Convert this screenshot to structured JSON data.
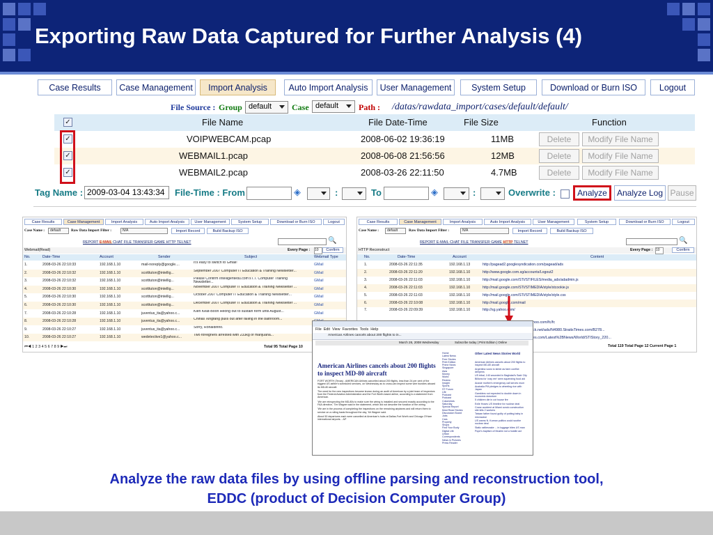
{
  "slide": {
    "title": "Exporting Raw Data Captured for Further Analysis (4)",
    "caption_line1": "Analyze the raw data files by using offline parsing and reconstruction tool,",
    "caption_line2": "EDDC (product of Decision Computer Group)"
  },
  "colors": {
    "title_bg": "#0d2478",
    "accent_red": "#d0101a",
    "caption": "#1d2ab8"
  },
  "main": {
    "nav": [
      "Case Results",
      "Case Management",
      "Import Analysis",
      "Auto Import Analysis",
      "User Management",
      "System Setup",
      "Download or Burn ISO",
      "Logout"
    ],
    "active_tab": "Import Analysis",
    "file_source_label": "File Source :",
    "group_label": "Group",
    "group_value": "default",
    "case_label": "Case",
    "case_value": "default",
    "path_label": "Path :",
    "path_value": "/datas/rawdata_import/cases/default/default/",
    "columns": [
      "File Name",
      "File Date-Time",
      "File Size",
      "Function"
    ],
    "files": [
      {
        "name": "VOIPWEBCAM.pcap",
        "datetime": "2008-06-02 19:36:19",
        "size": "11MB",
        "checked": true
      },
      {
        "name": "WEBMAIL1.pcap",
        "datetime": "2008-06-08 21:56:56",
        "size": "12MB",
        "checked": true
      },
      {
        "name": "WEBMAIL2.pcap",
        "datetime": "2008-03-26 22:11:50",
        "size": "4.7MB",
        "checked": true
      }
    ],
    "delete_label": "Delete",
    "modify_label": "Modify File Name",
    "tag_name_label": "Tag Name :",
    "tag_name_value": "2009-03-04 13:43:34",
    "file_time_from_label": "File-Time : From",
    "colon": ":",
    "to_label": "To",
    "overwrite_label": "Overwrite :",
    "analyze_label": "Analyze",
    "analyze_log_label": "Analyze Log",
    "pause_label": "Pause"
  },
  "left_panel": {
    "nav": [
      "Case Results",
      "Case Management",
      "Import Analysis",
      "Auto Import Analysis",
      "User Management",
      "System Setup",
      "Download or Burn ISO",
      "Logout"
    ],
    "case_name_label": "Case Name :",
    "case_name_value": "default",
    "filter_label": "Raw Data Import Filter :",
    "filter_value": "N/A",
    "import_record": "Import Record",
    "build_backup": "Build Backup ISO",
    "tabs": [
      "REPORT",
      "E-MAIL",
      "CHAT",
      "FILE TRANSFER",
      "GAME",
      "HTTP",
      "TELNET"
    ],
    "folder": "Webmail(Read)",
    "every_page": "Every Page :",
    "every_page_value": "10",
    "confirm": "Confirm",
    "columns": [
      "No.",
      "Date-Time",
      "Account",
      "Sender",
      "Subject",
      "Webmail Type"
    ],
    "rows": [
      [
        "1.",
        "2008-03-26 22:10:33",
        "192.168.1.10",
        "mail-noreply@google....",
        "It's easy to switch to Gmail!",
        "GMail"
      ],
      [
        "2.",
        "2008-03-26 22:10:32",
        "192.168.1.10",
        "scotttuton@intellig...",
        "September 2007 Computer IT Education & Training Newsletter...",
        "GMail"
      ],
      [
        "3.",
        "2008-03-26 22:10:32",
        "192.168.1.10",
        "scotttuton@intellig...",
        "Please Confirm Intelligentedu.com's I.T. Computer Training Newsletter...",
        "GMail"
      ],
      [
        "4.",
        "2008-03-26 22:10:30",
        "192.168.1.10",
        "scotttuton@intellig...",
        "November 2007 Computer IT Education & Training Newsletter ...",
        "GMail"
      ],
      [
        "5.",
        "2008-03-26 22:10:30",
        "192.168.1.10",
        "scotttuton@intellig...",
        "October 2007 Computer IT Education & Training Newsletter...",
        "GMail"
      ],
      [
        "6.",
        "2008-03-26 22:10:30",
        "192.168.1.10",
        "scotttuton@intellig...",
        "December 2007 Computer IT Education & Training Newsletter ...",
        "GMail"
      ],
      [
        "7.",
        "2008-03-26 22:10:28",
        "192.168.1.10",
        "juventus_ita@yahoo.c...",
        "Kien Keat-Boon Heong out to sustain form until August...",
        "GMail"
      ],
      [
        "8.",
        "2008-03-26 22:10:28",
        "192.168.1.10",
        "juventus_ita@yahoo.c...",
        "Chinas Xingfang pulls out after falling in the bathroom...",
        "GMail"
      ],
      [
        "9.",
        "2008-03-26 22:10:27",
        "192.168.1.10",
        "juventus_ita@yahoo.c...",
        "Sorry, Ronaldinho.",
        "GMail"
      ],
      [
        "10.",
        "2008-03-26 22:10:27",
        "192.168.1.10",
        "wedetective1@yahoo.c...",
        "Two foreigners arrested with 233kg of marijuana...",
        "GMail"
      ]
    ],
    "pager": "1 2 3 4 5 6 7 8 9",
    "total": "Total 95  Total Page 10"
  },
  "right_panel": {
    "nav": [
      "Case Results",
      "Case Management",
      "Import Analysis",
      "Auto Import Analysis",
      "User Management",
      "System Setup",
      "Download or Burn ISO",
      "Logout"
    ],
    "case_name_label": "Case Name :",
    "case_name_value": "default",
    "filter_label": "Raw Data Import Filter :",
    "filter_value": "N/A",
    "import_record": "Import Record",
    "build_backup": "Build Backup ISO",
    "tabs": [
      "REPORT",
      "E-MAIL",
      "CHAT",
      "FILE TRANSFER",
      "GAME",
      "HTTP",
      "TELNET"
    ],
    "folder": "HTTP Reconstruct",
    "every_page": "Every Page :",
    "every_page_value": "10",
    "confirm": "Confirm",
    "columns": [
      "No.",
      "Date-Time",
      "Account",
      "Content"
    ],
    "rows": [
      [
        "1.",
        "2008-03-26 22:11:35",
        "192.168.1.13",
        "http://pagead2.googlesyndication.com/pagead/ads"
      ],
      [
        "2.",
        "2008-03-26 22:11:20",
        "192.168.1.10",
        "http://www.google.com.sg/accounts/Logout2"
      ],
      [
        "3.",
        "2008-03-26 22:11:03",
        "192.168.1.10",
        "http://mail.google.com/STI/STIFILES/media_ads/adadmin.js"
      ],
      [
        "4.",
        "2008-03-26 22:11:03",
        "192.168.1.10",
        "http://mail.google.com/STI/STIMEDIA/style/stcookie.js"
      ],
      [
        "5.",
        "2008-03-26 22:11:03",
        "192.168.1.10",
        "http://mail.google.com/STI/STIMEDIA/style/style.css"
      ],
      [
        "6.",
        "2008-03-26 22:10:08",
        "192.168.1.10",
        "http://mail.google.com/mail"
      ],
      [
        "7.",
        "2008-03-26 22:09:39",
        "192.168.1.10",
        "http://sg.yahoo.com/"
      ]
    ],
    "partial_rows": [
      "hoo.com/fc/fc",
      "ck.net/ads/N4980.StraitsTimes.com/B278...",
      "es.com/Latest%2BNews/World/STIStory_220..."
    ],
    "total": "Total 119  Total Page 12  Current Page 1"
  },
  "browser": {
    "menu": [
      "File",
      "Edit",
      "View",
      "Favorites",
      "Tools",
      "Help"
    ],
    "tab_title": "American Airlines cancels about 200 flights to in...",
    "date_line": "March 26, 2008 Wednesday",
    "subscribe": "Subscribe today | Print Edition | Online",
    "headline": "American Airlines cancels about 200 flights to inspect MD-80 aircraft",
    "sidebar_title": "Other Latest News Stories World",
    "body": [
      "FORT WORTH (Texas) - AMERICAN Airlines cancelled about 200 flights, less than 24 per cent of the biggest US airline's scheduled services, on Wednesday as to cross-can inspect some wire bundles aboard its MD-80 aircraft.",
      "The need for the new inspections became known during an audit of American by a joint team of inspectors from the Federal Aviation Administration and the Fort Worth-based airline, according to a statement from American.",
      "'We are reinspecting the MD-80s to make sure the wiring is installed and secured exactly according to the FAA directive,' Tim Wagner said in the statement, which did not describe the function of the wiring.",
      "'We are in the process of completing the inspections on the remaining airplanes and will return them to service on a rolling basis throughout the day,' Mr Wagner said.",
      "About 50 departures each were cancelled at American's hubs at Dallas-Fort Worth and Chicago O'Hare international airports. - AP"
    ],
    "left_links": [
      "Home",
      "Latest News",
      "Free Stories",
      "Print Edition",
      "Prime News",
      "Singapore",
      "Asia",
      "Money",
      "World",
      "Review",
      "Insight",
      "Sports",
      "ST Forum",
      "Life",
      "Podcast",
      "Podcast",
      "Columnists",
      "Saturday",
      "Special Report",
      "Most Read Stories",
      "Discussion Board",
      "Jobs",
      "Cars",
      "Property",
      "Shops",
      "Find Your Body",
      "Digital Life",
      "Urban",
      "Correspondents",
      "News in Pictures",
      "Press Reader"
    ],
    "right_links": [
      "American Airlines cancels about 200 flights to inspect MD-80 aircraft",
      "Argentina vows to stride as farm conflict deepens",
      "US tribal, 140 wounded in Baghdad's Sadr City",
      "Billions for 'cray ree' seen squeezing food aid",
      "Aussie mother's emergency call serves mum",
      "Australia PM pledges to wheeling rice with Japan",
      "Gamblers not expected to double down in economic downturn",
      "5 children die in cot house fire",
      "Exile Hoses US timeline for nuclear deal",
      "Crane accident at Miami condo construction site kills 2 workers",
      "Taiwan father found guilty of putting baby in microwave",
      "US warns N. Korean politics could soothe nuclear deal",
      "Static rattlesnake ... in luggage bites US man",
      "Pope's baptism of Muslim not a hostile act"
    ]
  }
}
